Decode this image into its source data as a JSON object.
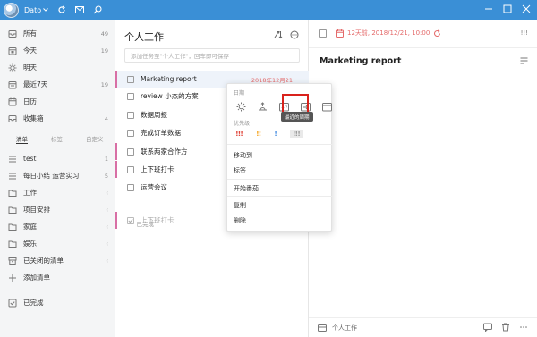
{
  "titlebar": {
    "username": "Dato"
  },
  "sidebar": {
    "smart_lists": [
      {
        "label": "所有",
        "count": "49"
      },
      {
        "label": "今天",
        "count": "19"
      },
      {
        "label": "明天",
        "count": ""
      },
      {
        "label": "最近7天",
        "count": "19"
      },
      {
        "label": "日历",
        "count": ""
      },
      {
        "label": "收集箱",
        "count": "4"
      }
    ],
    "tabs": [
      "清单",
      "标签",
      "自定义"
    ],
    "lists": [
      {
        "label": "test",
        "count": "1",
        "chevron": false
      },
      {
        "label": "每日小结 运营实习",
        "count": "5",
        "chevron": false
      },
      {
        "label": "工作",
        "count": "",
        "chevron": true
      },
      {
        "label": "项目安排",
        "count": "",
        "chevron": true
      },
      {
        "label": "家庭",
        "count": "",
        "chevron": true
      },
      {
        "label": "娱乐",
        "count": "",
        "chevron": true
      },
      {
        "label": "已关闭的清单",
        "count": "",
        "chevron": true
      }
    ],
    "add_list": "添加清单",
    "completed": "已完成"
  },
  "middle": {
    "title": "个人工作",
    "add_placeholder": "添加任务至\"个人工作\"，回车即可保存",
    "tasks": [
      {
        "title": "Marketing report",
        "date": "2018年12月21"
      },
      {
        "title": "review 小杰的方案",
        "date": ""
      },
      {
        "title": "数据周报",
        "date": ""
      },
      {
        "title": "完成订单数据",
        "date": ""
      },
      {
        "title": "联系两家合作方",
        "date": ""
      },
      {
        "title": "上下班打卡",
        "date": ""
      },
      {
        "title": "运营会议",
        "date": ""
      }
    ],
    "done_section": "已完成",
    "done_tasks": [
      {
        "title": "上下班打卡"
      }
    ]
  },
  "detail": {
    "date_text": "12天前, 2018/12/21, 10:00",
    "title": "Marketing report",
    "footer_list": "个人工作"
  },
  "menu": {
    "date_label": "日期",
    "tooltip": "最近的周期",
    "priority_label": "优先级",
    "priorities": [
      {
        "text": "!!!",
        "color": "#e0483d"
      },
      {
        "text": "!!",
        "color": "#f5a623"
      },
      {
        "text": "!",
        "color": "#4a90e2"
      },
      {
        "text": "!!!",
        "color": "#9b9b9b"
      }
    ],
    "items": [
      "移动到",
      "标签",
      "开始番茄",
      "复制",
      "删除"
    ]
  },
  "colors": {
    "titlebar": "#3a8fd6",
    "accent_red": "#e46a6a",
    "selected_bar": "#d86fa5",
    "highlight_box": "#d9221c"
  }
}
